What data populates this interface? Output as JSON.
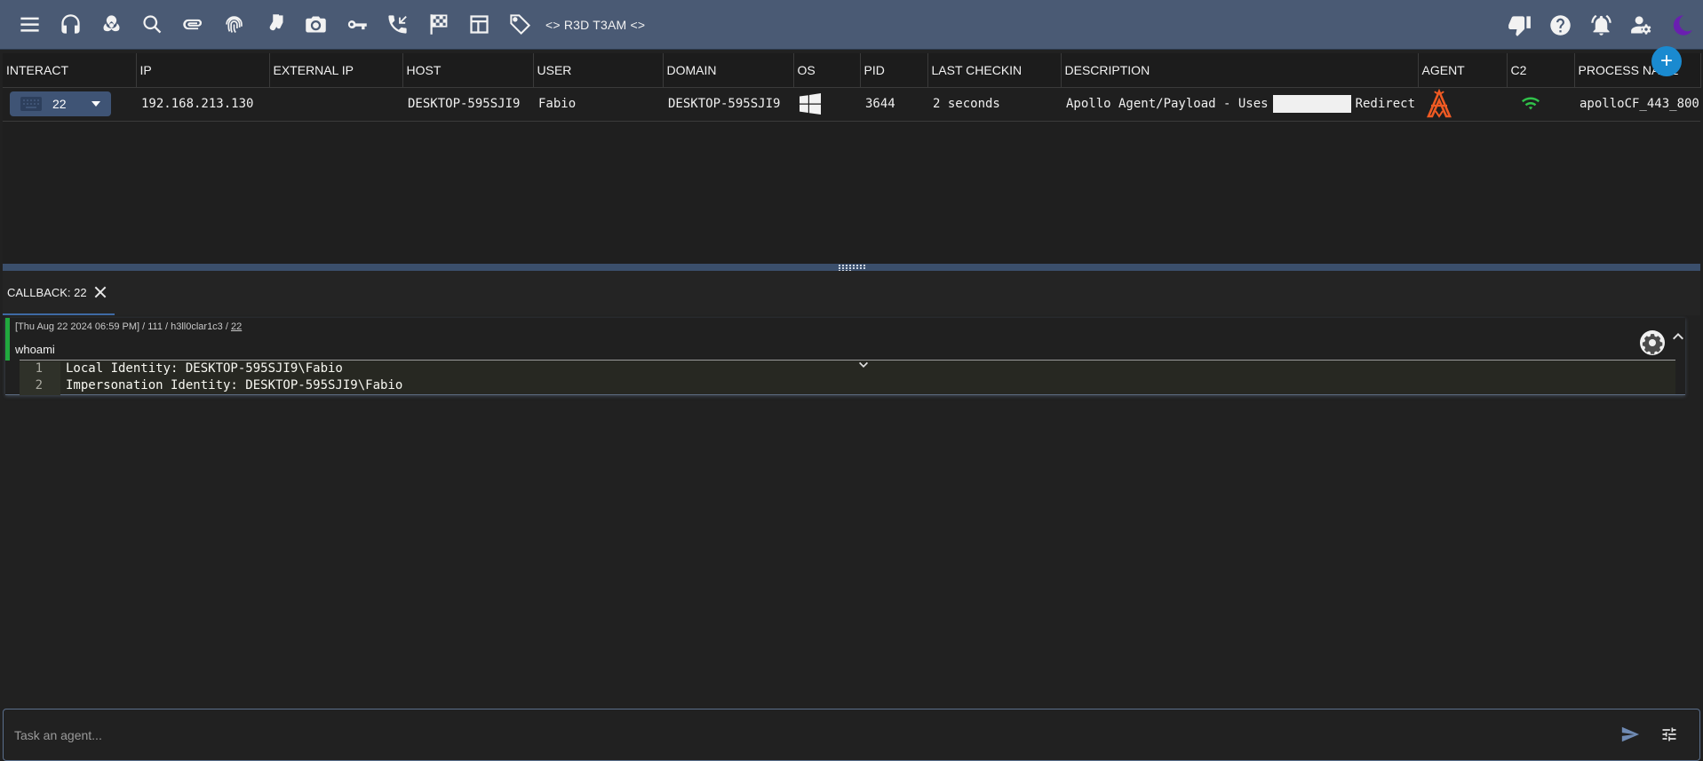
{
  "topbar": {
    "brand": "<> R3D T3AM <>",
    "left_icons": [
      "menu-icon",
      "headset-icon",
      "biohazard-icon",
      "search-icon",
      "attachment-icon",
      "fingerprint-icon",
      "socks-icon",
      "camera-icon",
      "key-icon",
      "phone-callback-icon",
      "checkered-flag-icon",
      "table-icon",
      "tag-icon"
    ],
    "right_icons": [
      "thumb-down-icon",
      "help-icon",
      "alarm-icon",
      "user-settings-icon",
      "moon-icon"
    ],
    "accent": "#4a5a74"
  },
  "table": {
    "columns": [
      "INTERACT",
      "IP",
      "EXTERNAL IP",
      "HOST",
      "USER",
      "DOMAIN",
      "OS",
      "PID",
      "LAST CHECKIN",
      "DESCRIPTION",
      "AGENT",
      "C2",
      "PROCESS NAME"
    ],
    "rows": [
      {
        "interact": "22",
        "ip": "192.168.213.130",
        "external_ip": "",
        "host": "DESKTOP-595SJI9",
        "user": "Fabio",
        "domain": "DESKTOP-595SJI9",
        "os": "windows-icon",
        "pid": "3644",
        "last_checkin": "2 seconds",
        "description_pre": "Apollo Agent/Payload - Uses",
        "description_post": "Redirect",
        "agent": "apollo-agent-icon",
        "c2": "wifi-icon",
        "process_name": "apolloCF_443_800"
      }
    ],
    "add_button": "+"
  },
  "callback_tab": {
    "label": "CALLBACK: 22"
  },
  "task": {
    "meta_prefix": "[Thu Aug 22 2024 06:59 PM] / 111 / h3ll0clar1c3 / ",
    "meta_callback": "22",
    "command": "whoami",
    "output_lines": [
      {
        "n": "1",
        "text": "Local Identity: DESKTOP-595SJI9\\Fabio"
      },
      {
        "n": "2",
        "text": "Impersonation Identity: DESKTOP-595SJI9\\Fabio"
      }
    ],
    "status_color": "#21a83e"
  },
  "input": {
    "placeholder": "Task an agent..."
  }
}
